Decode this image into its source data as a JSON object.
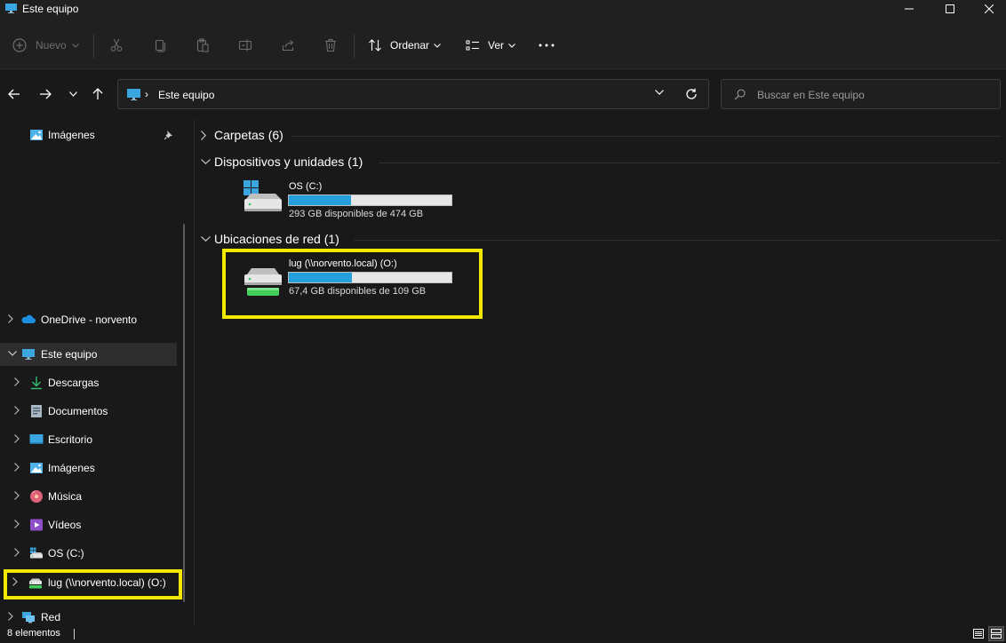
{
  "window": {
    "title": "Este equipo"
  },
  "toolbar": {
    "new_label": "Nuevo",
    "sort_label": "Ordenar",
    "view_label": "Ver"
  },
  "address": {
    "path": "Este equipo"
  },
  "search": {
    "placeholder": "Buscar en Este equipo"
  },
  "sidebar": {
    "pinned": [
      {
        "label": "Imágenes",
        "icon": "pictures-icon"
      }
    ],
    "items": [
      {
        "label": "OneDrive - norvento",
        "icon": "cloud-icon"
      },
      {
        "label": "Este equipo",
        "icon": "computer-icon",
        "selected": true
      },
      {
        "label": "Descargas",
        "icon": "download-icon"
      },
      {
        "label": "Documentos",
        "icon": "documents-icon"
      },
      {
        "label": "Escritorio",
        "icon": "desktop-icon"
      },
      {
        "label": "Imágenes",
        "icon": "pictures-icon"
      },
      {
        "label": "Música",
        "icon": "music-icon"
      },
      {
        "label": "Vídeos",
        "icon": "videos-icon"
      },
      {
        "label": "OS (C:)",
        "icon": "drive-icon"
      },
      {
        "label": "lug (\\\\norvento.local) (O:)",
        "icon": "network-drive-icon",
        "highlighted": true
      },
      {
        "label": "Red",
        "icon": "network-icon"
      }
    ]
  },
  "content": {
    "groups": [
      {
        "label": "Carpetas (6)",
        "expanded": false
      },
      {
        "label": "Dispositivos y unidades (1)",
        "expanded": true
      },
      {
        "label": "Ubicaciones de red (1)",
        "expanded": true
      }
    ],
    "drives": [
      {
        "name": "OS (C:)",
        "free_text": "293 GB disponibles de 474 GB",
        "used_fraction": 0.38
      },
      {
        "name": "lug (\\\\norvento.local) (O:)",
        "free_text": "67,4 GB disponibles de 109 GB",
        "used_fraction": 0.39,
        "highlighted": true
      }
    ]
  },
  "status": {
    "item_count": "8 elementos"
  },
  "colors": {
    "accent": "#26a0da",
    "highlight": "#f2e900",
    "background": "#191919"
  }
}
